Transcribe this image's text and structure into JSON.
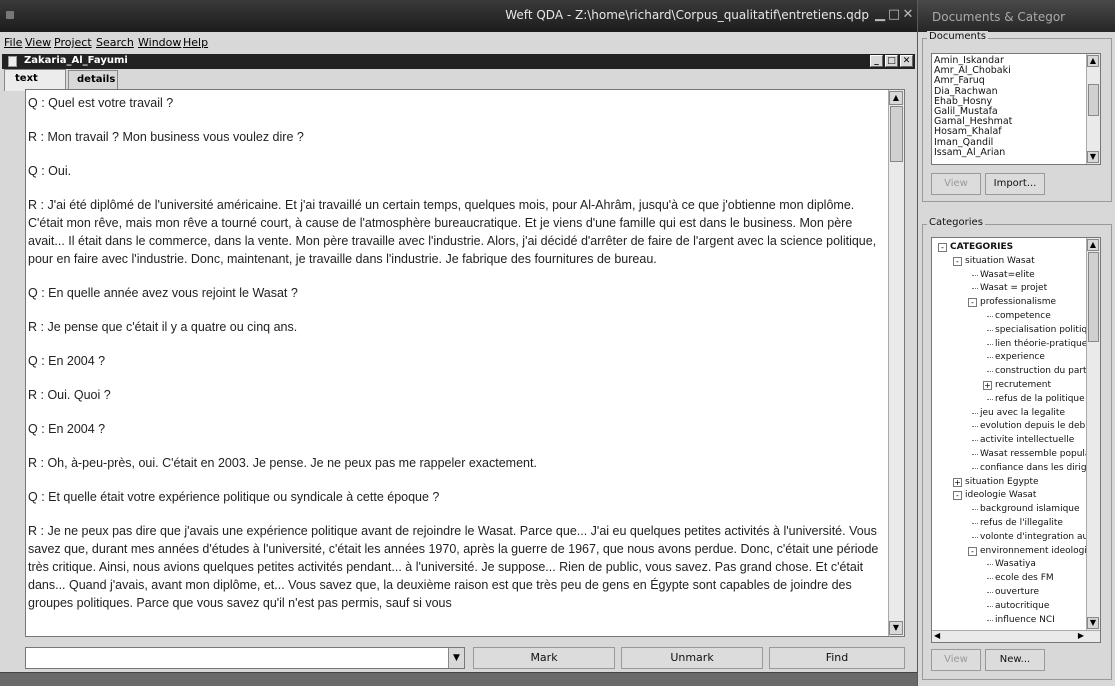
{
  "app": {
    "title": "Weft QDA - Z:\\home\\richard\\Corpus_qualitatif\\entretiens.qdp",
    "menu": [
      {
        "label": "File"
      },
      {
        "label": "View"
      },
      {
        "label": "Project"
      },
      {
        "label": "Search"
      },
      {
        "label": "Window"
      },
      {
        "label": "Help"
      }
    ]
  },
  "document": {
    "title": "Zakaria_Al_Fayumi",
    "tabs": [
      {
        "label": "text"
      },
      {
        "label": "details"
      }
    ],
    "paragraphs": [
      "Q : Quel est votre travail ?",
      "R : Mon travail ? Mon business vous voulez dire ?",
      "Q : Oui.",
      "R : J'ai été diplômé de l'université américaine. Et j'ai travaillé un certain temps, quelques mois, pour Al-Ahrâm, jusqu'à ce que j'obtienne mon diplôme. C'était mon rêve, mais mon rêve a tourné court, à cause de l'atmosphère bureaucratique. Et je viens d'une famille qui est dans le business. Mon père avait... Il était dans le commerce, dans la vente. Mon père travaille avec l'industrie. Alors, j'ai décidé d'arrêter de faire de l'argent avec la science politique, pour en faire avec l'industrie. Donc, maintenant, je travaille dans l'industrie. Je fabrique des fournitures de bureau.",
      "Q : En quelle année avez vous rejoint le Wasat ?",
      "R : Je pense que c'était il y a quatre ou cinq ans.",
      "Q : En 2004 ?",
      "R : Oui. Quoi ?",
      "Q : En 2004 ?",
      "R : Oh, à-peu-près, oui. C'était en 2003. Je pense. Je ne peux pas me rappeler exactement.",
      "Q : Et quelle était votre expérience politique ou syndicale à cette époque ?",
      "R : Je ne peux pas dire que j'avais une expérience politique avant de rejoindre le Wasat. Parce que... J'ai eu quelques petites activités à l'université. Vous savez que, durant mes années d'études à l'université, c'était les années 1970, après la guerre de 1967, que nous avons perdue. Donc, c'était une période très critique. Ainsi, nous avions quelques petites activités pendant... à l'université. Je suppose... Rien de public, vous savez. Pas grand chose. Et c'était dans... Quand j'avais, avant mon diplôme, et... Vous savez que, la deuxième raison est que très peu de gens en Égypte sont capables de joindre des groupes politiques. Parce que vous savez qu'il n'est pas permis, sauf si vous"
    ],
    "buttons": {
      "mark": "Mark",
      "unmark": "Unmark",
      "find": "Find"
    },
    "code_select_value": ""
  },
  "side": {
    "title": "Documents & Categor",
    "documents_label": "Documents",
    "documents": [
      "Amin_Iskandar",
      "Amr_Al_Chobaki",
      "Amr_Faruq",
      "Dia_Rachwan",
      "Ehab_Hosny",
      "Galil_Mustafa",
      "Gamal_Heshmat",
      "Hosam_Khalaf",
      "Iman_Qandil",
      "Issam_Al_Arian"
    ],
    "doc_buttons": {
      "view": "View",
      "import": "Import..."
    },
    "categories_label": "Categories",
    "categories": [
      {
        "label": "CATEGORIES",
        "level": 0,
        "toggle": "-",
        "bold": true
      },
      {
        "label": "situation Wasat",
        "level": 1,
        "toggle": "-"
      },
      {
        "label": "Wasat=elite",
        "level": 2
      },
      {
        "label": "Wasat = projet",
        "level": 2
      },
      {
        "label": "professionalisme",
        "level": 2,
        "toggle": "-"
      },
      {
        "label": "competence",
        "level": 3
      },
      {
        "label": "specialisation politique",
        "level": 3
      },
      {
        "label": "lien théorie-pratique",
        "level": 3
      },
      {
        "label": "experience",
        "level": 3
      },
      {
        "label": "construction du parti",
        "level": 3
      },
      {
        "label": "recrutement",
        "level": 3,
        "toggle": "+"
      },
      {
        "label": "refus de la politique",
        "level": 3
      },
      {
        "label": "jeu avec la legalite",
        "level": 2
      },
      {
        "label": "evolution depuis le debut",
        "level": 2
      },
      {
        "label": "activite intellectuelle",
        "level": 2
      },
      {
        "label": "Wasat ressemble populat",
        "level": 2
      },
      {
        "label": "confiance dans les dirigea",
        "level": 2
      },
      {
        "label": "situation Egypte",
        "level": 1,
        "toggle": "+"
      },
      {
        "label": "ideologie Wasat",
        "level": 1,
        "toggle": "-"
      },
      {
        "label": "background islamique",
        "level": 2
      },
      {
        "label": "refus de l'illegalite",
        "level": 2
      },
      {
        "label": "volonte d'integration au s",
        "level": 2
      },
      {
        "label": "environnement ideologiqu",
        "level": 2,
        "toggle": "-"
      },
      {
        "label": "Wasatiya",
        "level": 3
      },
      {
        "label": "ecole des FM",
        "level": 3
      },
      {
        "label": "ouverture",
        "level": 3
      },
      {
        "label": "autocritique",
        "level": 3
      },
      {
        "label": "influence NCI",
        "level": 3
      }
    ],
    "cat_buttons": {
      "view": "View",
      "new": "New..."
    }
  }
}
